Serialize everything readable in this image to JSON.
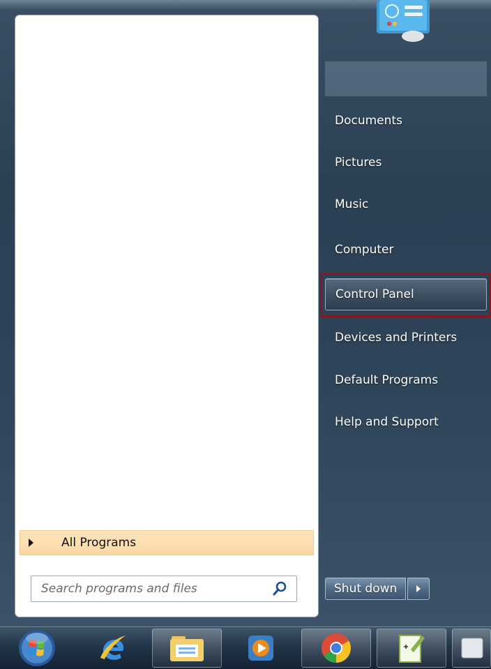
{
  "right_pane": {
    "items": [
      {
        "label": "Documents"
      },
      {
        "label": "Pictures"
      },
      {
        "label": "Music"
      },
      {
        "label": "Computer"
      },
      {
        "label": "Control Panel"
      },
      {
        "label": "Devices and Printers"
      },
      {
        "label": "Default Programs"
      },
      {
        "label": "Help and Support"
      }
    ],
    "highlighted": "Control Panel"
  },
  "left_pane": {
    "all_programs_label": "All Programs",
    "search_placeholder": "Search programs and files"
  },
  "shutdown": {
    "label": "Shut down"
  },
  "taskbar": {
    "icons": [
      "windows-start-orb-icon",
      "internet-explorer-icon",
      "file-explorer-icon",
      "media-player-icon",
      "chrome-icon",
      "notepad-plus-plus-icon",
      "window-icon"
    ]
  },
  "colors": {
    "highlight_frame": "#8b1620",
    "all_programs_bg": "#fbd8a4",
    "menu_bg": "#2e4458"
  }
}
